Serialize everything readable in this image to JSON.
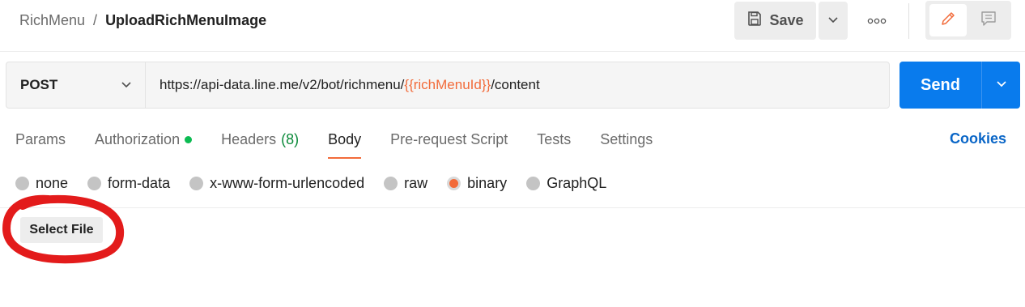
{
  "header": {
    "breadcrumb_parent": "RichMenu",
    "breadcrumb_separator": "/",
    "breadcrumb_current": "UploadRichMenuImage",
    "save_label": "Save"
  },
  "request": {
    "method": "POST",
    "url_prefix": "https://api-data.line.me/v2/bot/richmenu/",
    "url_variable": "{{richMenuId}}",
    "url_suffix": "/content",
    "send_label": "Send"
  },
  "tabs": {
    "params": "Params",
    "authorization": "Authorization",
    "headers": "Headers",
    "headers_count": "(8)",
    "body": "Body",
    "prerequest": "Pre-request Script",
    "tests": "Tests",
    "settings": "Settings",
    "active": "Body"
  },
  "cookies_label": "Cookies",
  "body_types": {
    "none": "none",
    "form_data": "form-data",
    "urlencoded": "x-www-form-urlencoded",
    "raw": "raw",
    "binary": "binary",
    "graphql": "GraphQL",
    "selected": "binary"
  },
  "select_file_label": "Select File",
  "colors": {
    "accent": "#f26b3a",
    "send": "#097bed",
    "cookies": "#0a66c7",
    "status_green": "#0cbb52",
    "annotation_red": "#e31b1b"
  }
}
